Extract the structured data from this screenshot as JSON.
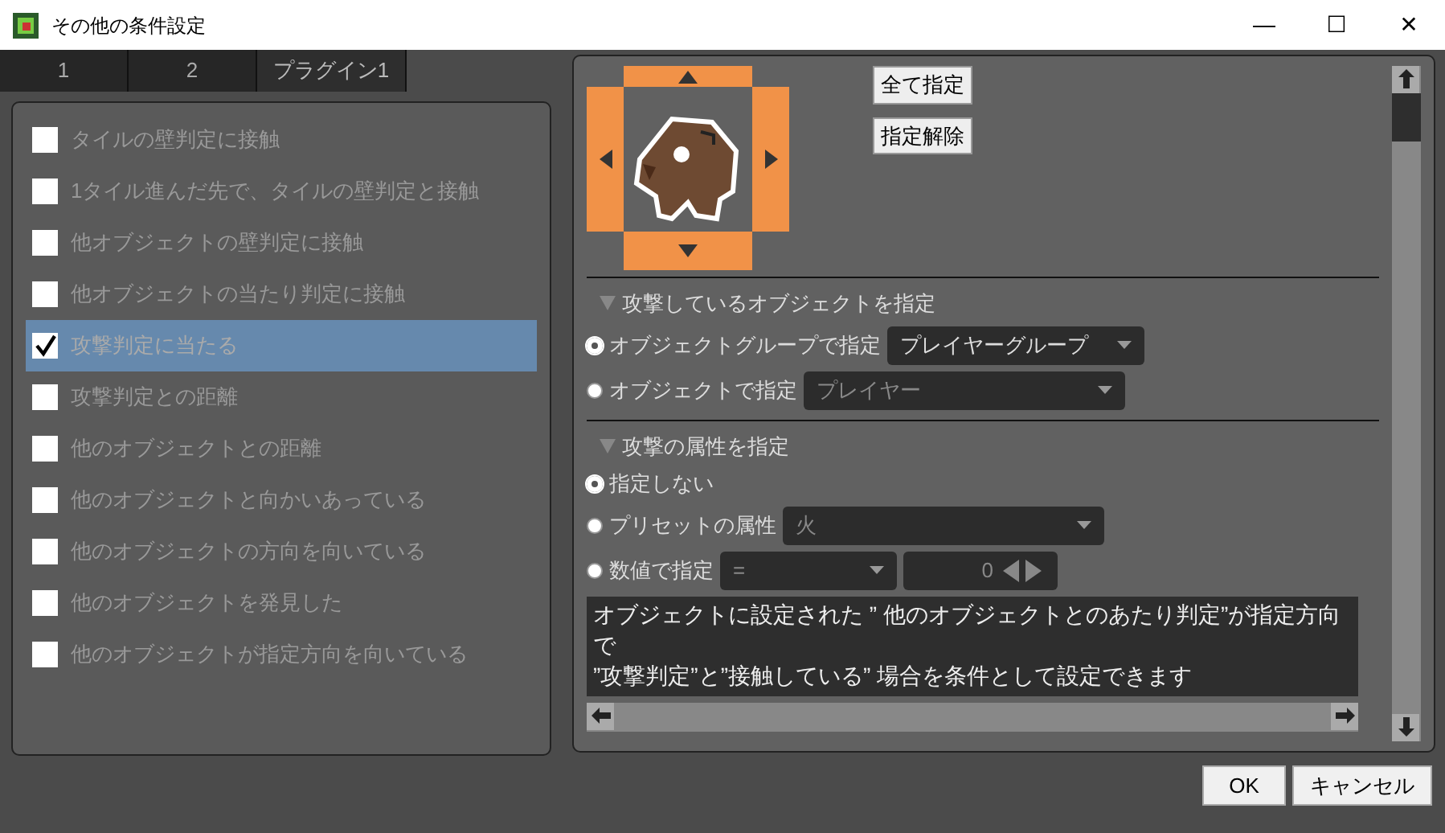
{
  "window": {
    "title": "その他の条件設定",
    "controls": [
      "—",
      "☐",
      "✕"
    ]
  },
  "tabs": [
    {
      "label": "1",
      "selected": false
    },
    {
      "label": "2",
      "selected": false
    },
    {
      "label": "プラグイン1",
      "selected": true
    }
  ],
  "conditions": [
    {
      "label": "タイルの壁判定に接触",
      "checked": false,
      "selected": false
    },
    {
      "label": "1タイル進んだ先で、タイルの壁判定と接触",
      "checked": false,
      "selected": false
    },
    {
      "label": "他オブジェクトの壁判定に接触",
      "checked": false,
      "selected": false
    },
    {
      "label": "他オブジェクトの当たり判定に接触",
      "checked": false,
      "selected": false
    },
    {
      "label": "攻撃判定に当たる",
      "checked": true,
      "selected": true
    },
    {
      "label": "攻撃判定との距離",
      "checked": false,
      "selected": false
    },
    {
      "label": "他のオブジェクトとの距離",
      "checked": false,
      "selected": false
    },
    {
      "label": "他のオブジェクトと向かいあっている",
      "checked": false,
      "selected": false
    },
    {
      "label": "他のオブジェクトの方向を向いている",
      "checked": false,
      "selected": false
    },
    {
      "label": "他のオブジェクトを発見した",
      "checked": false,
      "selected": false
    },
    {
      "label": "他のオブジェクトが指定方向を向いている",
      "checked": false,
      "selected": false
    }
  ],
  "direction_buttons": [
    "全て指定",
    "指定解除"
  ],
  "sections": [
    {
      "title": "攻撃しているオブジェクトを指定",
      "expanded": true,
      "options": [
        {
          "label": "オブジェクトグループで指定",
          "selected": true,
          "kind": "select",
          "value": "プレイヤーグループ",
          "disabled": false
        },
        {
          "label": "オブジェクトで指定",
          "selected": false,
          "kind": "select",
          "value": "プレイヤー",
          "disabled": true
        }
      ]
    },
    {
      "title": "攻撃の属性を指定",
      "expanded": true,
      "options": [
        {
          "label": "指定しない",
          "selected": true,
          "kind": "plain"
        },
        {
          "label": "プリセットの属性",
          "selected": false,
          "kind": "select",
          "value": "火",
          "disabled": true
        },
        {
          "label": "数値で指定",
          "selected": false,
          "kind": "compare",
          "value": "=",
          "number": "0",
          "disabled": true
        }
      ]
    }
  ],
  "description": [
    "オブジェクトに設定された ” 他のオブジェクトとのあたり判定”が指定方向で",
    "”攻撃判定”と”接触している” 場合を条件として設定できます"
  ],
  "buttons": [
    "OK",
    "キャンセル"
  ]
}
